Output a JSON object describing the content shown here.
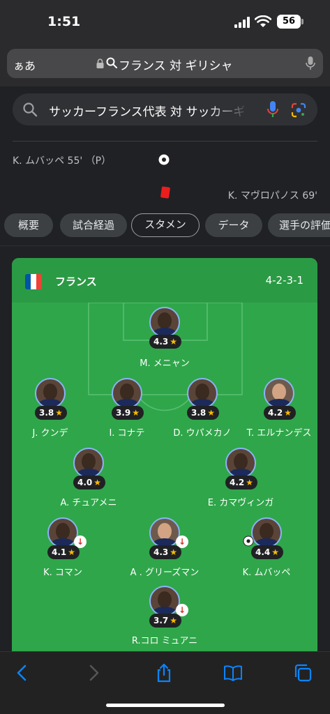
{
  "status_bar": {
    "time": "1:51",
    "battery": "56"
  },
  "browser": {
    "aa_label": "ぁあ",
    "url_text": "フランス 対 ギリシャ"
  },
  "search": {
    "query": "サッカーフランス代表 対 サッカーギリシャ代表"
  },
  "events": {
    "home_goal": "K. ムバッペ 55' （P）",
    "away_card": "K. マヴロパノス 69'"
  },
  "tabs": [
    {
      "label": "概要"
    },
    {
      "label": "試合経過"
    },
    {
      "label": "スタメン",
      "active": true
    },
    {
      "label": "データ"
    },
    {
      "label": "選手の評価"
    }
  ],
  "lineup": {
    "team": "フランス",
    "formation": "4-2-3-1",
    "flag_colors": [
      "#0055a4",
      "#ffffff",
      "#ef4135"
    ],
    "players": [
      {
        "name": "M. メニャン",
        "rating": "4.3"
      },
      {
        "name": "J. クンデ",
        "rating": "3.8"
      },
      {
        "name": "I. コナテ",
        "rating": "3.9"
      },
      {
        "name": "D. ウパメカノ",
        "rating": "3.8"
      },
      {
        "name": "T. エルナンデス",
        "rating": "4.2"
      },
      {
        "name": "A. チュアメニ",
        "rating": "4.0"
      },
      {
        "name": "E. カマヴィンガ",
        "rating": "4.2"
      },
      {
        "name": "K. コマン",
        "rating": "4.1",
        "subbed_off": true
      },
      {
        "name": "A . グリーズマン",
        "rating": "4.3",
        "subbed_off": true
      },
      {
        "name": "K. ムバッペ",
        "rating": "4.4",
        "scored": true
      },
      {
        "name": "R.コロ ミュアニ",
        "rating": "3.7",
        "subbed_off": true
      }
    ]
  },
  "colors": {
    "pitch": "#2fa64a",
    "rating_star": "#fbbc04",
    "accent_blue": "#8ab4f8",
    "red_card": "#ea1e1e"
  },
  "icons": [
    "back-icon",
    "forward-icon",
    "share-icon",
    "bookmarks-icon",
    "tabs-icon",
    "search-icon",
    "mic-icon",
    "lens-icon",
    "lock-icon"
  ]
}
